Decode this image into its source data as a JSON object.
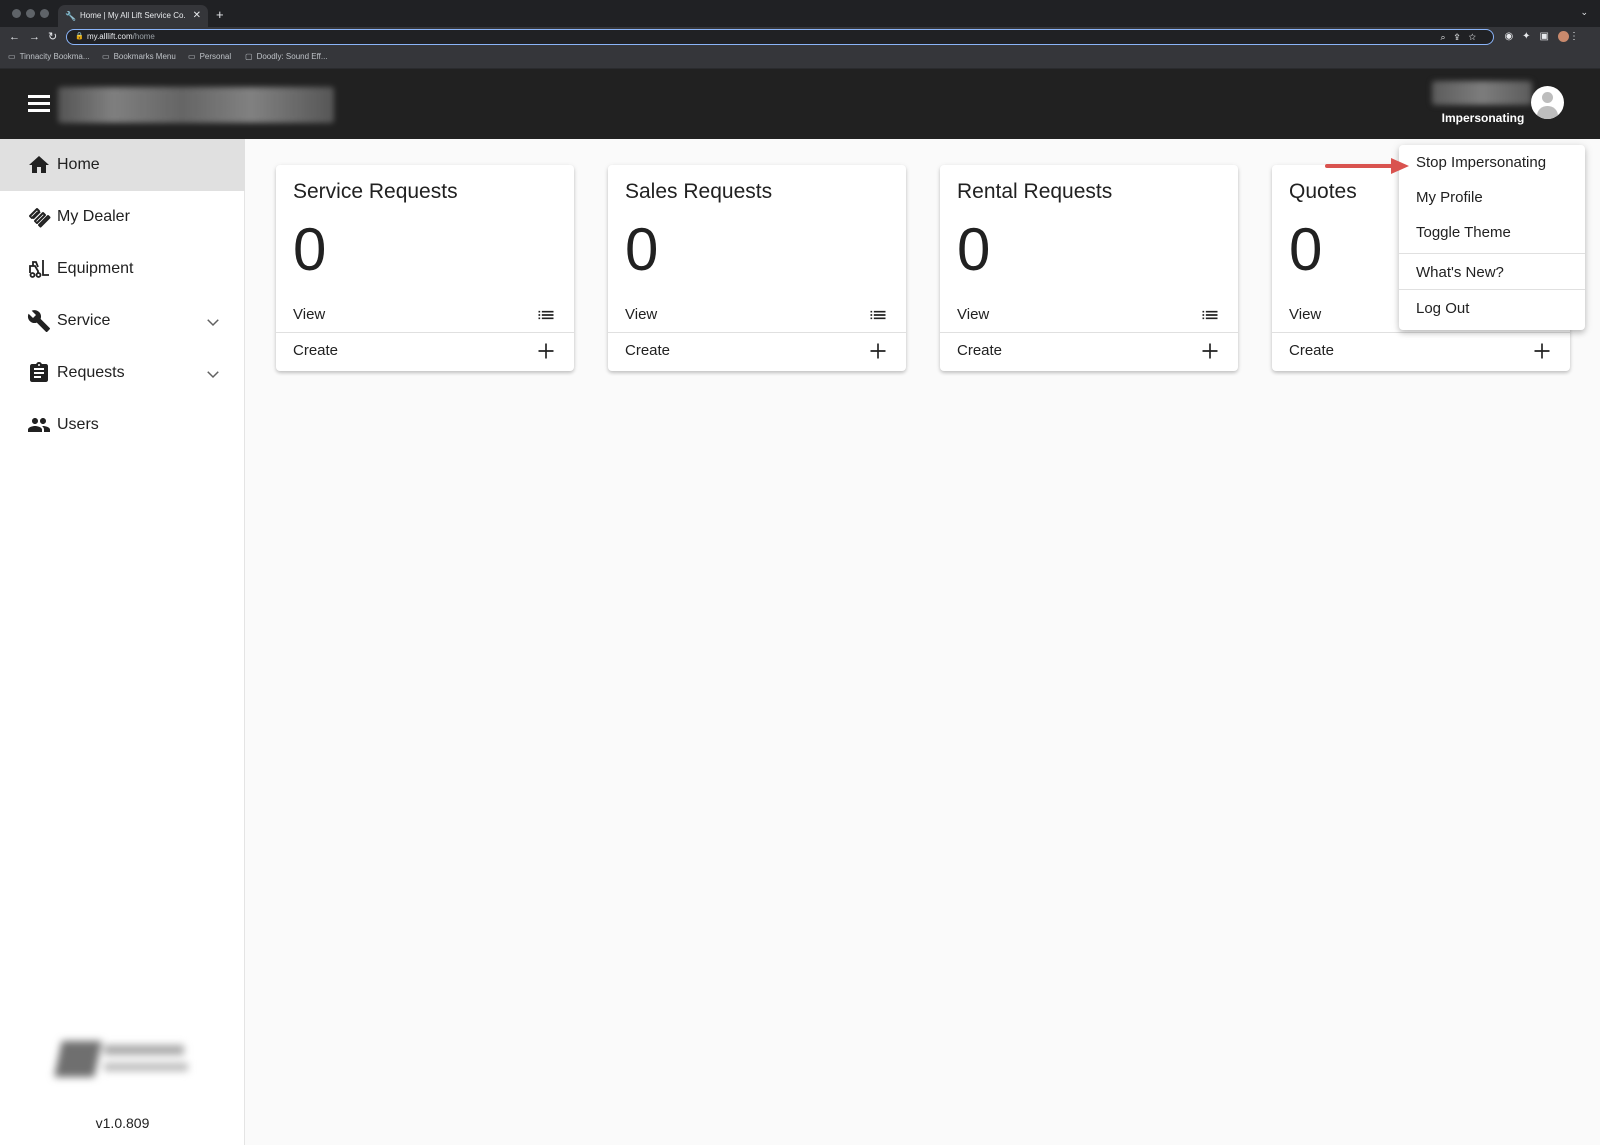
{
  "browser": {
    "tab_title": "Home | My All Lift Service Co.",
    "new_tab": "+",
    "url_host": "my.alllift.com",
    "url_path": "/home",
    "bookmarks": [
      {
        "label": "Tinnacity Bookma..."
      },
      {
        "label": "Bookmarks Menu"
      },
      {
        "label": "Personal"
      },
      {
        "label": "Doodly: Sound Eff..."
      }
    ]
  },
  "header": {
    "status_label": "Impersonating"
  },
  "sidebar": {
    "items": [
      {
        "label": "Home",
        "icon": "home-icon",
        "active": true
      },
      {
        "label": "My Dealer",
        "icon": "handshake-icon"
      },
      {
        "label": "Equipment",
        "icon": "forklift-icon"
      },
      {
        "label": "Service",
        "icon": "wrench-icon",
        "expandable": true
      },
      {
        "label": "Requests",
        "icon": "clipboard-icon",
        "expandable": true
      },
      {
        "label": "Users",
        "icon": "users-icon"
      }
    ],
    "version": "v1.0.809"
  },
  "cards": [
    {
      "title": "Service Requests",
      "count": "0",
      "view_label": "View",
      "create_label": "Create"
    },
    {
      "title": "Sales Requests",
      "count": "0",
      "view_label": "View",
      "create_label": "Create"
    },
    {
      "title": "Rental Requests",
      "count": "0",
      "view_label": "View",
      "create_label": "Create"
    },
    {
      "title": "Quotes",
      "count": "0",
      "view_label": "View",
      "create_label": "Create"
    }
  ],
  "user_menu": {
    "items": [
      {
        "label": "Stop Impersonating"
      },
      {
        "label": "My Profile"
      },
      {
        "label": "Toggle Theme"
      },
      {
        "label": "What's New?"
      },
      {
        "label": "Log Out"
      }
    ]
  },
  "colors": {
    "header_bg": "#212121",
    "sidebar_active_bg": "#e0e0e0",
    "main_bg": "#fafafa",
    "annotation_arrow": "#d9534f"
  }
}
